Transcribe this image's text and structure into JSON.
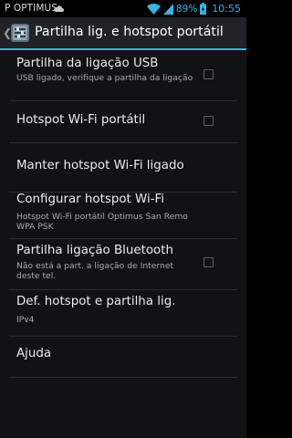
{
  "status_bar": {
    "carrier": "P OPTIMUS",
    "battery_text": "89%",
    "time": "10:55",
    "icons": [
      "cloud-icon",
      "wifi-icon",
      "signal-icon",
      "battery-icon"
    ]
  },
  "action_bar": {
    "title": "Partilha lig. e hotspot portátil",
    "icons": [
      "up-caret-icon",
      "settings-app-icon"
    ]
  },
  "items": [
    {
      "title": "Partilha da ligação USB",
      "summary": "USB ligado, verifique a partilha da ligação",
      "checkbox": true,
      "checked": false
    },
    {
      "title": "Hotspot Wi-Fi portátil",
      "summary": "",
      "checkbox": true,
      "checked": false
    },
    {
      "title": "Manter hotspot Wi-Fi ligado",
      "summary": "",
      "checkbox": false
    },
    {
      "title": "Configurar hotspot Wi-Fi",
      "summary": "Hotspot Wi-Fi portátil Optimus San Remo WPA PSK",
      "checkbox": false
    },
    {
      "title": "Partilha ligação Bluetooth",
      "summary": "Não está a part. a ligação de Internet deste tel.",
      "checkbox": true,
      "checked": false
    },
    {
      "title": "Def. hotspot e partilha lig.",
      "summary": "IPv4",
      "checkbox": false
    },
    {
      "title": "Ajuda",
      "summary": "",
      "checkbox": false
    }
  ],
  "colors": {
    "accent": "#33b5e5",
    "background": "#101214",
    "action_bar": "#202225"
  }
}
